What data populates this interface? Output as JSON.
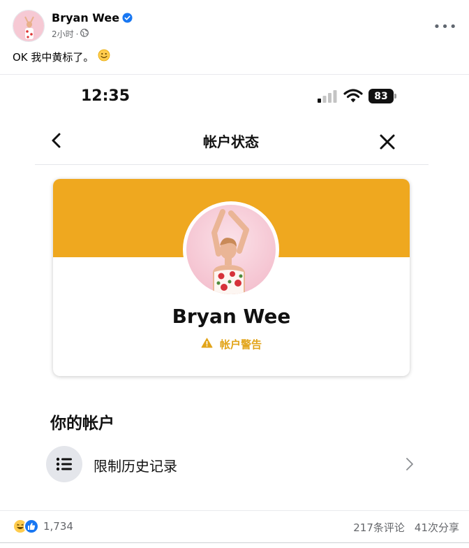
{
  "post": {
    "author": "Bryan Wee",
    "time": "2小时",
    "meta_dot": "·",
    "more_label": "•••",
    "text": "OK 我中黄标了。"
  },
  "phone": {
    "status_time": "12:35",
    "battery": "83",
    "nav_title": "帐户状态",
    "card": {
      "name": "Bryan Wee",
      "warning": "帐户警告",
      "banner_color": "#efa81f",
      "warning_color": "#e2a419"
    },
    "section_title": "你的帐户",
    "menu_item": "限制历史记录"
  },
  "stats": {
    "reaction_count": "1,734",
    "comments": "217条评论",
    "shares": "41次分享"
  },
  "icons": [
    "verified-badge-icon",
    "globe-icon",
    "smile-emoji-icon",
    "signal-icon",
    "wifi-icon",
    "back-arrow-icon",
    "close-icon",
    "warning-icon",
    "list-icon",
    "chevron-right-icon",
    "haha-reaction-icon",
    "like-reaction-icon"
  ]
}
